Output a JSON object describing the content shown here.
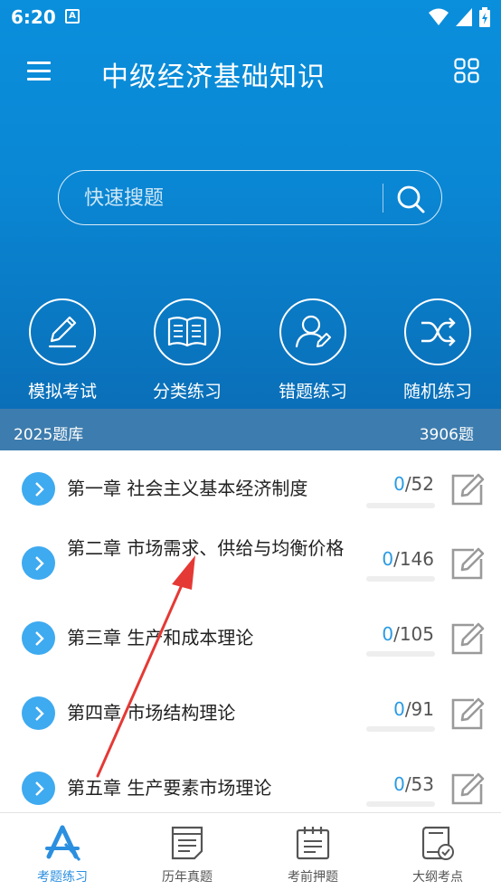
{
  "status_bar": {
    "time": "6:20",
    "notif_icon": "A"
  },
  "header": {
    "title": "中级经济基础知识",
    "menu_icon": "menu-icon",
    "grid_icon": "grid-icon"
  },
  "search": {
    "placeholder": "快速搜题"
  },
  "actions": [
    {
      "label": "模拟考试",
      "icon": "pen-icon"
    },
    {
      "label": "分类练习",
      "icon": "book-icon"
    },
    {
      "label": "错题练习",
      "icon": "user-edit-icon"
    },
    {
      "label": "随机练习",
      "icon": "shuffle-icon"
    }
  ],
  "bank": {
    "name": "2025题库",
    "total": "3906题"
  },
  "chapters": [
    {
      "name": "第一章 社会主义基本经济制度",
      "done": "0",
      "total": "/52",
      "progress": 0
    },
    {
      "name": "第二章 市场需求、供给与均衡价格",
      "done": "0",
      "total": "/146",
      "progress": 0
    },
    {
      "name": "第三章 生产和成本理论",
      "done": "0",
      "total": "/105",
      "progress": 0
    },
    {
      "name": "第四章 市场结构理论",
      "done": "0",
      "total": "/91",
      "progress": 0
    },
    {
      "name": "第五章 生产要素市场理论",
      "done": "0",
      "total": "/53",
      "progress": 0
    }
  ],
  "tabs": [
    {
      "label": "考题练习",
      "icon": "exam-practice-icon",
      "active": true
    },
    {
      "label": "历年真题",
      "icon": "paper-icon",
      "active": false
    },
    {
      "label": "考前押题",
      "icon": "calendar-list-icon",
      "active": false
    },
    {
      "label": "大纲考点",
      "icon": "outline-book-icon",
      "active": false
    }
  ],
  "colors": {
    "hero": "#0a8fdc",
    "accent": "#2b9be3",
    "bank_bar": "#3d7cae",
    "annotation": "#e53935"
  }
}
